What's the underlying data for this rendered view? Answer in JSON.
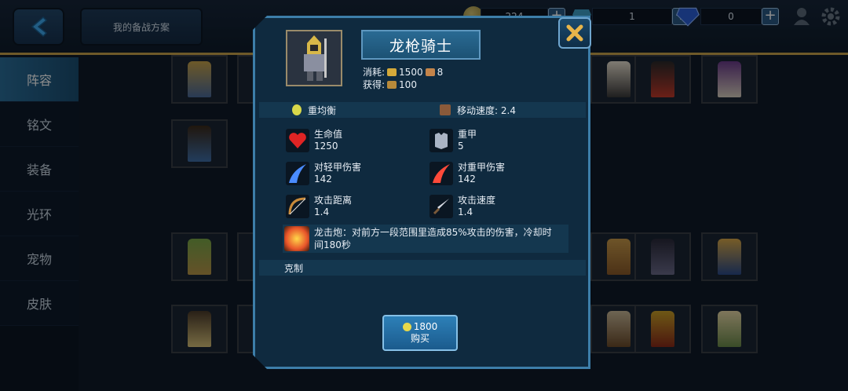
{
  "topbar": {
    "plan_label": "我的备战方案",
    "coins": "224",
    "tickets": "1",
    "diamonds": "0",
    "plus_label": "+"
  },
  "sidebar": {
    "items": [
      {
        "label": "阵容"
      },
      {
        "label": "铭文"
      },
      {
        "label": "装备"
      },
      {
        "label": "光环"
      },
      {
        "label": "宠物"
      },
      {
        "label": "皮肤"
      }
    ],
    "active_index": 0
  },
  "hero": {
    "name": "龙枪骑士",
    "cost_label": "消耗:",
    "cost_gold": "1500",
    "cost_pop": "8",
    "gain_label": "获得:",
    "gain_value": "100",
    "balance": "重均衡",
    "move_speed": "移动速度: 2.4",
    "stats": [
      {
        "label": "生命值",
        "value": "1250",
        "icon": "heart-icon"
      },
      {
        "label": "重甲",
        "value": "5",
        "icon": "heavy-armor-icon"
      },
      {
        "label": "对轻甲伤害",
        "value": "142",
        "icon": "blue-slash-icon"
      },
      {
        "label": "对重甲伤害",
        "value": "142",
        "icon": "red-slash-icon"
      },
      {
        "label": "攻击距离",
        "value": "1.4",
        "icon": "bow-icon"
      },
      {
        "label": "攻击速度",
        "value": "1.4",
        "icon": "dagger-icon"
      }
    ],
    "skill_text": "龙击炮：对前方一段范围里造成85%攻击的伤害，冷却时",
    "skill_text2": "间180秒",
    "counter_label": "克制"
  },
  "buy": {
    "price": "1800",
    "label": "购买"
  },
  "colors": {
    "accent": "#3d7ea9",
    "gold": "#c9a24c",
    "panel": "#0f2a3f"
  }
}
